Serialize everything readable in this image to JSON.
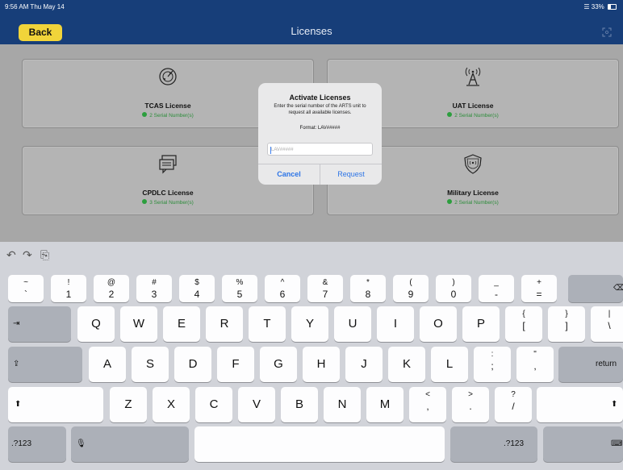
{
  "status": {
    "time": "9:56 AM  Thu May 14",
    "battery": "33%"
  },
  "nav": {
    "back_label": "Back",
    "title": "Licenses"
  },
  "cards": [
    {
      "title": "TCAS License",
      "subtitle": "2 Serial Number(s)",
      "icon": "radar-icon"
    },
    {
      "title": "UAT License",
      "subtitle": "2 Serial Number(s)",
      "icon": "antenna-tower-icon"
    },
    {
      "title": "CPDLC License",
      "subtitle": "3 Serial Number(s)",
      "icon": "message-icon"
    },
    {
      "title": "Military License",
      "subtitle": "2 Serial Number(s)",
      "icon": "shield-icon"
    }
  ],
  "dialog": {
    "title": "Activate Licenses",
    "message": "Enter the serial number of the ARTS unit to request all available licenses.",
    "format": "Format: LAV#####",
    "input_placeholder": "LAV#####",
    "cancel_label": "Cancel",
    "request_label": "Request"
  },
  "keyboard": {
    "row1": [
      {
        "top": "~",
        "bot": "`"
      },
      {
        "top": "!",
        "bot": "1"
      },
      {
        "top": "@",
        "bot": "2"
      },
      {
        "top": "#",
        "bot": "3"
      },
      {
        "top": "$",
        "bot": "4"
      },
      {
        "top": "%",
        "bot": "5"
      },
      {
        "top": "^",
        "bot": "6"
      },
      {
        "top": "&",
        "bot": "7"
      },
      {
        "top": "*",
        "bot": "8"
      },
      {
        "top": "(",
        "bot": "9"
      },
      {
        "top": ")",
        "bot": "0"
      },
      {
        "top": "_",
        "bot": "-"
      },
      {
        "top": "+",
        "bot": "="
      }
    ],
    "row2": [
      "Q",
      "W",
      "E",
      "R",
      "T",
      "Y",
      "U",
      "I",
      "O",
      "P"
    ],
    "row2_extra": [
      {
        "top": "{",
        "bot": "["
      },
      {
        "top": "}",
        "bot": "]"
      },
      {
        "top": "|",
        "bot": "\\"
      }
    ],
    "row3": [
      "A",
      "S",
      "D",
      "F",
      "G",
      "H",
      "J",
      "K",
      "L"
    ],
    "row3_extra": [
      {
        "top": ":",
        "bot": ";"
      },
      {
        "top": "\"",
        "bot": ","
      }
    ],
    "row4": [
      "Z",
      "X",
      "C",
      "V",
      "B",
      "N",
      "M"
    ],
    "row4_extra": [
      {
        "top": "<",
        "bot": ","
      },
      {
        "top": ">",
        "bot": "."
      },
      {
        "top": "?",
        "bot": "/"
      }
    ],
    "return_label": "return",
    "numbers_label": ".?123",
    "numbers_label_right": ".?123"
  }
}
